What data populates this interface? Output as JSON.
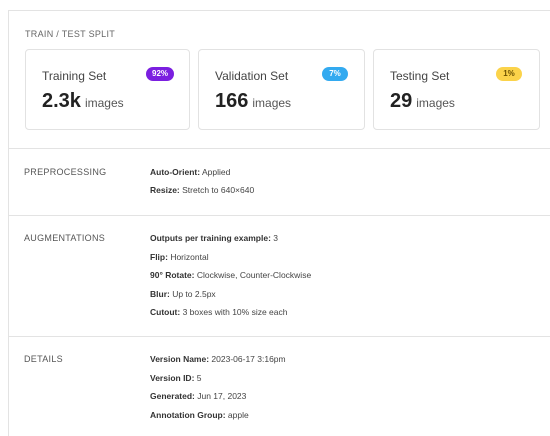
{
  "split": {
    "title": "TRAIN / TEST SPLIT",
    "cards": [
      {
        "label": "Training Set",
        "percent": "92%",
        "count": "2.3k",
        "unit": "images",
        "badge_bg": "#7b1fe0",
        "badge_fg": "#ffffff"
      },
      {
        "label": "Validation Set",
        "percent": "7%",
        "count": "166",
        "unit": "images",
        "badge_bg": "#33aaf0",
        "badge_fg": "#ffffff"
      },
      {
        "label": "Testing Set",
        "percent": "1%",
        "count": "29",
        "unit": "images",
        "badge_bg": "#fbd34a",
        "badge_fg": "#6b5100"
      }
    ]
  },
  "preprocessing": {
    "title": "PREPROCESSING",
    "items": [
      {
        "key": "Auto-Orient:",
        "value": " Applied"
      },
      {
        "key": "Resize:",
        "value": " Stretch to 640×640"
      }
    ]
  },
  "augmentations": {
    "title": "AUGMENTATIONS",
    "items": [
      {
        "key": "Outputs per training example:",
        "value": " 3"
      },
      {
        "key": "Flip:",
        "value": " Horizontal"
      },
      {
        "key": "90° Rotate:",
        "value": " Clockwise, Counter-Clockwise"
      },
      {
        "key": "Blur:",
        "value": " Up to 2.5px"
      },
      {
        "key": "Cutout:",
        "value": " 3 boxes with 10% size each"
      }
    ]
  },
  "details": {
    "title": "DETAILS",
    "items": [
      {
        "key": "Version Name:",
        "value": " 2023-06-17 3:16pm"
      },
      {
        "key": "Version ID:",
        "value": " 5"
      },
      {
        "key": "Generated:",
        "value": " Jun 17, 2023"
      },
      {
        "key": "Annotation Group:",
        "value": " apple"
      }
    ]
  }
}
